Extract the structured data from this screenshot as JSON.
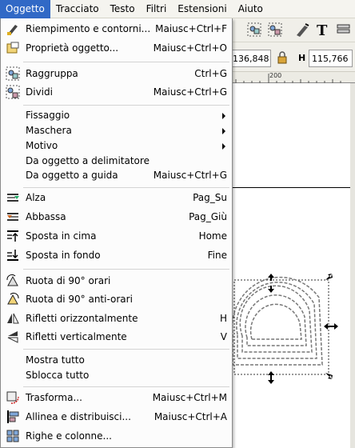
{
  "menubar": {
    "items": [
      "Oggetto",
      "Tracciato",
      "Testo",
      "Filtri",
      "Estensioni",
      "Aiuto"
    ]
  },
  "coords": {
    "w_value": "136,848",
    "h_label": "H",
    "h_value": "115,766"
  },
  "ruler": {
    "tick": "200"
  },
  "menu": {
    "items": [
      {
        "label": "Riempimento e contorni...",
        "shortcut": "Maiusc+Ctrl+F",
        "icon": "fill-stroke-icon"
      },
      {
        "label": "Proprietà oggetto...",
        "shortcut": "Maiusc+Ctrl+O",
        "icon": "object-properties-icon"
      },
      {
        "label": "Raggruppa",
        "shortcut": "Ctrl+G",
        "icon": "group-icon"
      },
      {
        "label": "Dividi",
        "shortcut": "Maiusc+Ctrl+G",
        "icon": "ungroup-icon"
      },
      {
        "label": "Fissaggio",
        "shortcut": "",
        "icon": ""
      },
      {
        "label": "Maschera",
        "shortcut": "",
        "icon": ""
      },
      {
        "label": "Motivo",
        "shortcut": "",
        "icon": ""
      },
      {
        "label": "Da oggetto a delimitatore",
        "shortcut": "",
        "icon": ""
      },
      {
        "label": "Da oggetto a guida",
        "shortcut": "Maiusc+Ctrl+G",
        "icon": ""
      },
      {
        "label": "Alza",
        "shortcut": "Pag_Su",
        "icon": "raise-icon"
      },
      {
        "label": "Abbassa",
        "shortcut": "Pag_Giù",
        "icon": "lower-icon"
      },
      {
        "label": "Sposta in cima",
        "shortcut": "Home",
        "icon": "raise-to-top-icon"
      },
      {
        "label": "Sposta in fondo",
        "shortcut": "Fine",
        "icon": "lower-to-bottom-icon"
      },
      {
        "label": "Ruota di 90° orari",
        "shortcut": "",
        "icon": "rotate-cw-icon"
      },
      {
        "label": "Ruota di 90° anti-orari",
        "shortcut": "",
        "icon": "rotate-ccw-icon"
      },
      {
        "label": "Rifletti orizzontalmente",
        "shortcut": "H",
        "icon": "flip-horizontal-icon"
      },
      {
        "label": "Rifletti verticalmente",
        "shortcut": "V",
        "icon": "flip-vertical-icon"
      },
      {
        "label": "Mostra tutto",
        "shortcut": "",
        "icon": ""
      },
      {
        "label": "Sblocca tutto",
        "shortcut": "",
        "icon": ""
      },
      {
        "label": "Trasforma...",
        "shortcut": "Maiusc+Ctrl+M",
        "icon": "transform-icon"
      },
      {
        "label": "Allinea e distribuisci...",
        "shortcut": "Maiusc+Ctrl+A",
        "icon": "align-distribute-icon"
      },
      {
        "label": "Righe e colonne...",
        "shortcut": "",
        "icon": "rows-columns-icon"
      }
    ]
  }
}
